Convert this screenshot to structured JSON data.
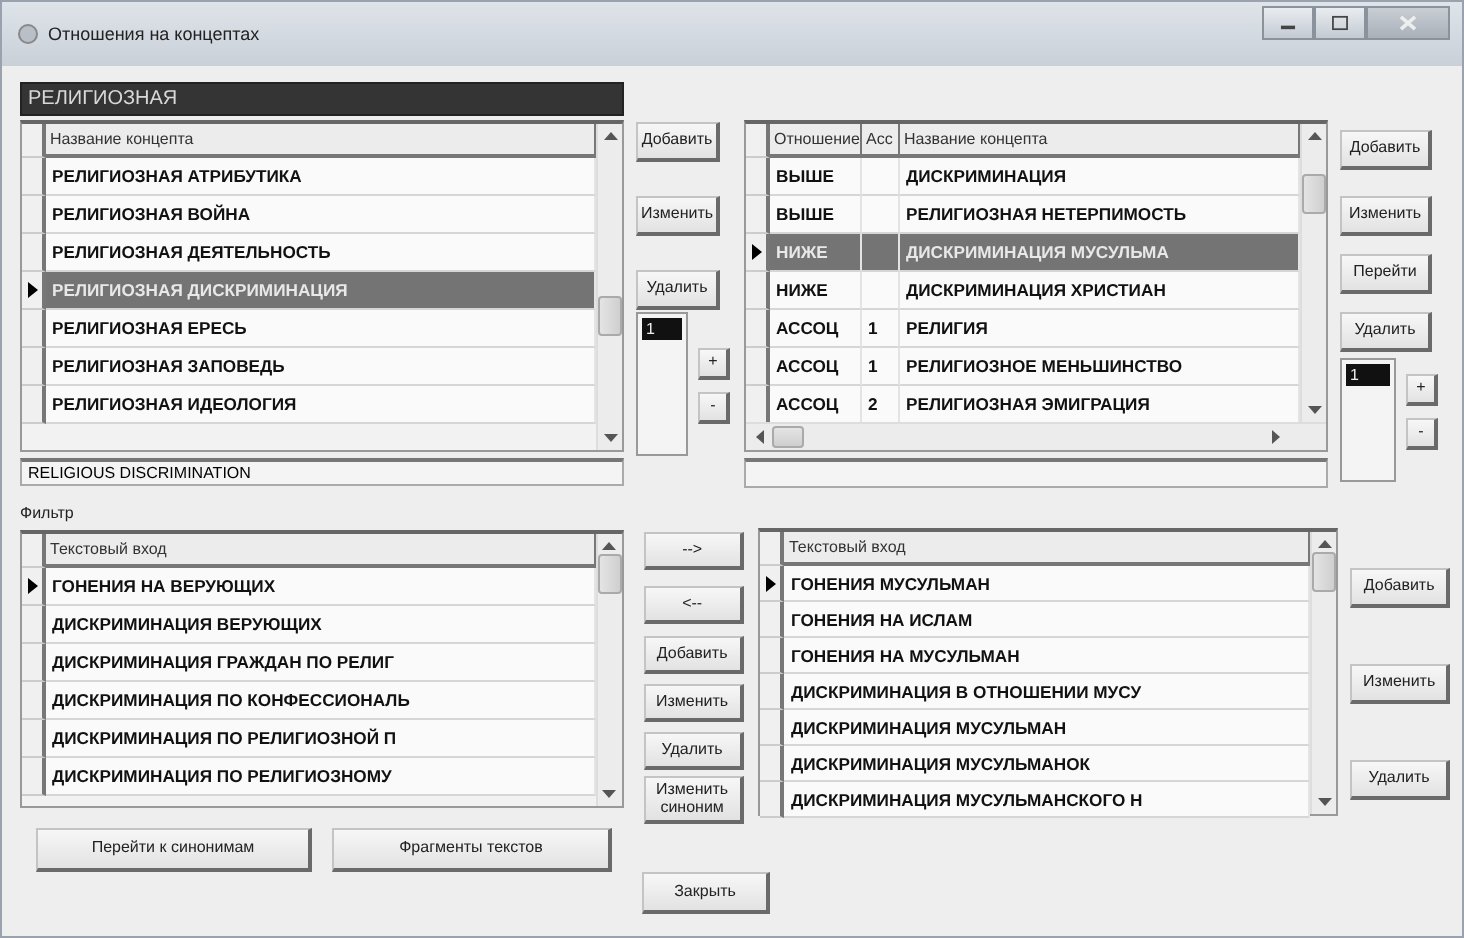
{
  "window": {
    "title": "Отношения на концептах"
  },
  "concept": {
    "value": "РЕЛИГИОЗНАЯ"
  },
  "concepts_grid": {
    "columns": [
      "Название концепта"
    ],
    "rows": [
      {
        "cells": [
          "РЕЛИГИОЗНАЯ АТРИБУТИКА"
        ],
        "selected": false,
        "current": false
      },
      {
        "cells": [
          "РЕЛИГИОЗНАЯ ВОЙНА"
        ],
        "selected": false,
        "current": false
      },
      {
        "cells": [
          "РЕЛИГИОЗНАЯ ДЕЯТЕЛЬНОСТЬ"
        ],
        "selected": false,
        "current": false
      },
      {
        "cells": [
          "РЕЛИГИОЗНАЯ ДИСКРИМИНАЦИЯ"
        ],
        "selected": true,
        "current": true
      },
      {
        "cells": [
          "РЕЛИГИОЗНАЯ ЕРЕСЬ"
        ],
        "selected": false,
        "current": false
      },
      {
        "cells": [
          "РЕЛИГИОЗНАЯ ЗАПОВЕДЬ"
        ],
        "selected": false,
        "current": false
      },
      {
        "cells": [
          "РЕЛИГИОЗНАЯ ИДЕОЛОГИЯ"
        ],
        "selected": false,
        "current": false
      }
    ]
  },
  "concept_translation": {
    "value": "RELIGIOUS DISCRIMINATION"
  },
  "concept_buttons": [
    "Добавить",
    "Изменить",
    "Удалить"
  ],
  "concept_levels": {
    "items": [
      {
        "label": "1",
        "selected": true
      }
    ],
    "buttons": [
      "+",
      "-"
    ]
  },
  "relations_grid": {
    "columns": [
      "Отношение",
      "Асс",
      "Название концепта"
    ],
    "rows": [
      {
        "cells": [
          "ВЫШЕ",
          "",
          "ДИСКРИМИНАЦИЯ"
        ],
        "selected": false,
        "current": false
      },
      {
        "cells": [
          "ВЫШЕ",
          "",
          "РЕЛИГИОЗНАЯ НЕТЕРПИМОСТЬ"
        ],
        "selected": false,
        "current": false
      },
      {
        "cells": [
          "НИЖЕ",
          "",
          "ДИСКРИМИНАЦИЯ МУСУЛЬМА"
        ],
        "selected": true,
        "current": true
      },
      {
        "cells": [
          "НИЖЕ",
          "",
          "ДИСКРИМИНАЦИЯ ХРИСТИАН"
        ],
        "selected": false,
        "current": false
      },
      {
        "cells": [
          "АССОЦ",
          "1",
          "РЕЛИГИЯ"
        ],
        "selected": false,
        "current": false
      },
      {
        "cells": [
          "АССОЦ",
          "1",
          "РЕЛИГИОЗНОЕ МЕНЬШИНСТВО"
        ],
        "selected": false,
        "current": false
      },
      {
        "cells": [
          "АССОЦ",
          "2",
          "РЕЛИГИОЗНАЯ ЭМИГРАЦИЯ"
        ],
        "selected": false,
        "current": false
      }
    ]
  },
  "relation_buttons": [
    "Добавить",
    "Изменить",
    "Перейти",
    "Удалить"
  ],
  "relation_levels": {
    "items": [
      {
        "label": "1",
        "selected": true
      }
    ],
    "buttons": [
      "+",
      "-"
    ]
  },
  "filter": {
    "label": "Фильтр"
  },
  "entries_grid": {
    "columns": [
      "Текстовый вход"
    ],
    "rows": [
      {
        "cells": [
          "ГОНЕНИЯ НА ВЕРУЮЩИХ"
        ],
        "selected": false,
        "current": true
      },
      {
        "cells": [
          "ДИСКРИМИНАЦИЯ ВЕРУЮЩИХ"
        ],
        "selected": false,
        "current": false
      },
      {
        "cells": [
          "ДИСКРИМИНАЦИЯ ГРАЖДАН ПО РЕЛИГ"
        ],
        "selected": false,
        "current": false
      },
      {
        "cells": [
          "ДИСКРИМИНАЦИЯ ПО КОНФЕССИОНАЛЬ"
        ],
        "selected": false,
        "current": false
      },
      {
        "cells": [
          "ДИСКРИМИНАЦИЯ ПО РЕЛИГИОЗНОЙ П"
        ],
        "selected": false,
        "current": false
      },
      {
        "cells": [
          "ДИСКРИМИНАЦИЯ ПО РЕЛИГИОЗНОМУ"
        ],
        "selected": false,
        "current": false
      }
    ]
  },
  "transfer_buttons": [
    "-->",
    "<--",
    "Добавить",
    "Изменить",
    "Удалить",
    "Изменить синоним"
  ],
  "synonyms_grid": {
    "columns": [
      "Текстовый вход"
    ],
    "rows": [
      {
        "cells": [
          "ГОНЕНИЯ МУСУЛЬМАН"
        ],
        "selected": false,
        "current": true
      },
      {
        "cells": [
          "ГОНЕНИЯ НА ИСЛАМ"
        ],
        "selected": false,
        "current": false
      },
      {
        "cells": [
          "ГОНЕНИЯ НА МУСУЛЬМАН"
        ],
        "selected": false,
        "current": false
      },
      {
        "cells": [
          "ДИСКРИМИНАЦИЯ В ОТНОШЕНИИ МУСУ"
        ],
        "selected": false,
        "current": false
      },
      {
        "cells": [
          "ДИСКРИМИНАЦИЯ МУСУЛЬМАН"
        ],
        "selected": false,
        "current": false
      },
      {
        "cells": [
          "ДИСКРИМИНАЦИЯ МУСУЛЬМАНОК"
        ],
        "selected": false,
        "current": false
      },
      {
        "cells": [
          "ДИСКРИМИНАЦИЯ МУСУЛЬМАНСКОГО Н"
        ],
        "selected": false,
        "current": false
      }
    ]
  },
  "synonym_buttons": [
    "Добавить",
    "Изменить",
    "Удалить"
  ],
  "bottom_buttons": [
    "Перейти к синонимам",
    "Фрагменты текстов"
  ],
  "close_button": "Закрыть"
}
